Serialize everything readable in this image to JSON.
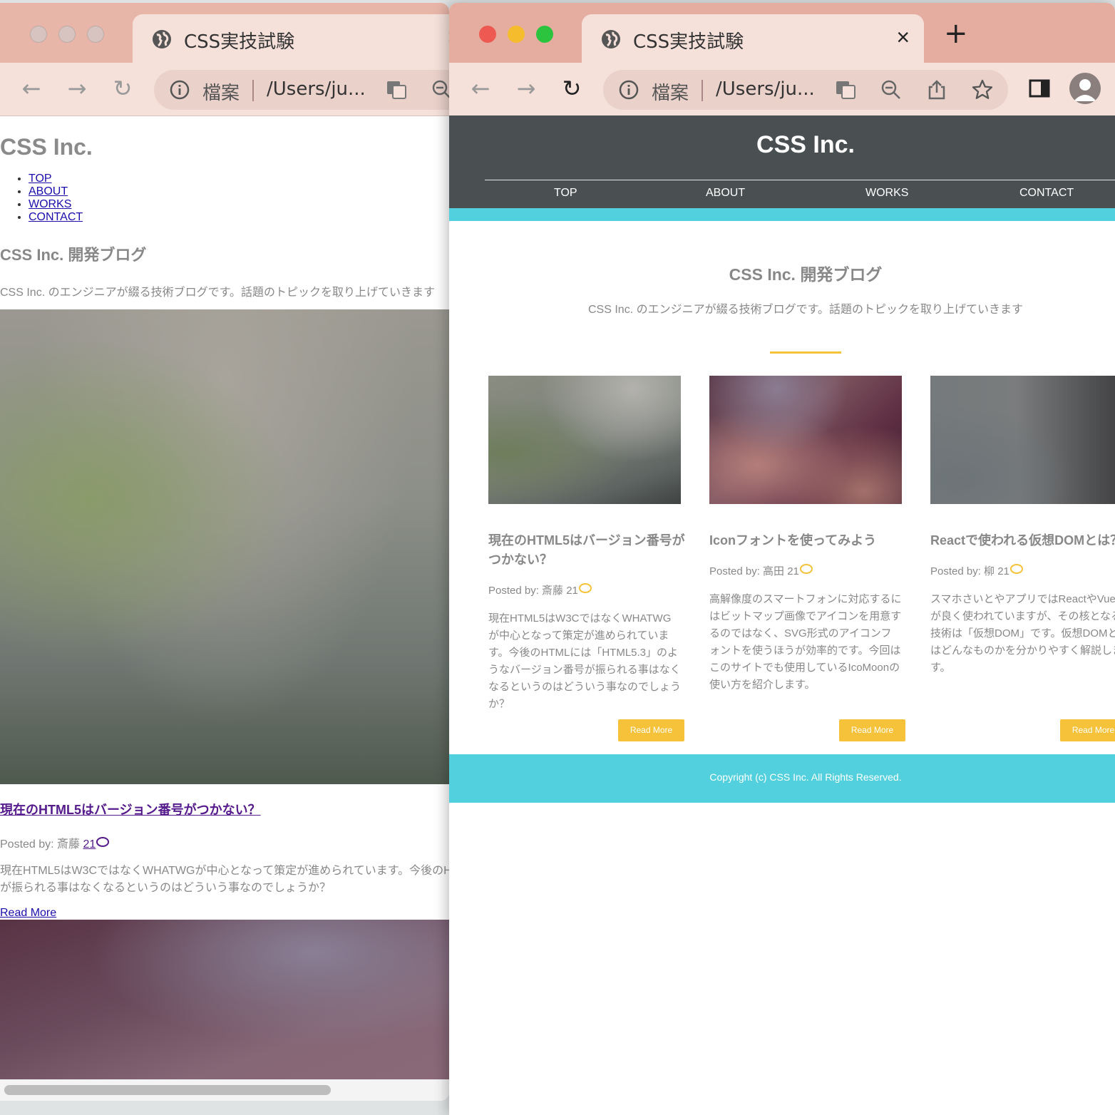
{
  "left_window": {
    "tab": {
      "title": "CSS実技試験"
    },
    "address": {
      "label": "檔案",
      "url": "/Users/ju..."
    },
    "page": {
      "logo": "CSS Inc.",
      "nav": [
        "TOP",
        "ABOUT",
        "WORKS",
        "CONTACT"
      ],
      "heading": "CSS Inc. 開発ブログ",
      "description": "CSS Inc. のエンジニアが綴る技術ブログです。話題のトピックを取り上げていきます",
      "post": {
        "title": "現在のHTML5はバージョン番号がつかない？",
        "meta_prefix": "Posted by: 斎藤",
        "comments": "21",
        "excerpt": "現在HTML5はW3CではなくWHATWGが中心となって策定が進められています。今後のH 号が振られる事はなくなるというのはどういう事なのでしょうか？",
        "read_more": "Read More"
      }
    }
  },
  "right_window": {
    "tab": {
      "title": "CSS実技試験",
      "new_tab": "+"
    },
    "address": {
      "label": "檔案",
      "url": "/Users/ju..."
    },
    "page": {
      "logo": "CSS Inc.",
      "nav": [
        "TOP",
        "ABOUT",
        "WORKS",
        "CONTACT"
      ],
      "heading": "CSS Inc. 開発ブログ",
      "description": "CSS Inc. のエンジニアが綴る技術ブログです。話題のトピックを取り上げていきます",
      "cards": [
        {
          "title": "現在のHTML5はバージョン番号がつかない？",
          "author": "Posted by: 斎藤",
          "comments": "21",
          "excerpt": "現在HTML5はW3CではなくWHATWGが中心となって策定が進められています。今後のHTMLには「HTML5.3」のようなバージョン番号が振られる事はなくなるというのはどういう事なのでしょうか？",
          "button": "Read More"
        },
        {
          "title": "Iconフォントを使ってみよう",
          "author": "Posted by: 高田",
          "comments": "21",
          "excerpt": "高解像度のスマートフォンに対応するにはビットマップ画像でアイコンを用意するのではなく、SVG形式のアイコンフォントを使うほうが効率的です。今回はこのサイトでも使用しているIcoMoonの使い方を紹介します。",
          "button": "Read More"
        },
        {
          "title": "Reactで使われる仮想DOMとは？",
          "author": "Posted by: 柳",
          "comments": "21",
          "excerpt": "スマホさいとやアプリではReactやVueが良く使われていますが、その核となる技術は「仮想DOM」です。仮想DOMとはどんなものかを分かりやすく解説します。",
          "button": "Read More"
        }
      ],
      "footer": "Copyright (c) CSS Inc. All Rights Reserved."
    }
  },
  "colors": {
    "header_bg": "#4a5052",
    "accent_cyan": "#52d0dd",
    "accent_yellow": "#f5c23a",
    "tab_bar": "#e4ada0",
    "toolbar": "#f5e0da"
  }
}
